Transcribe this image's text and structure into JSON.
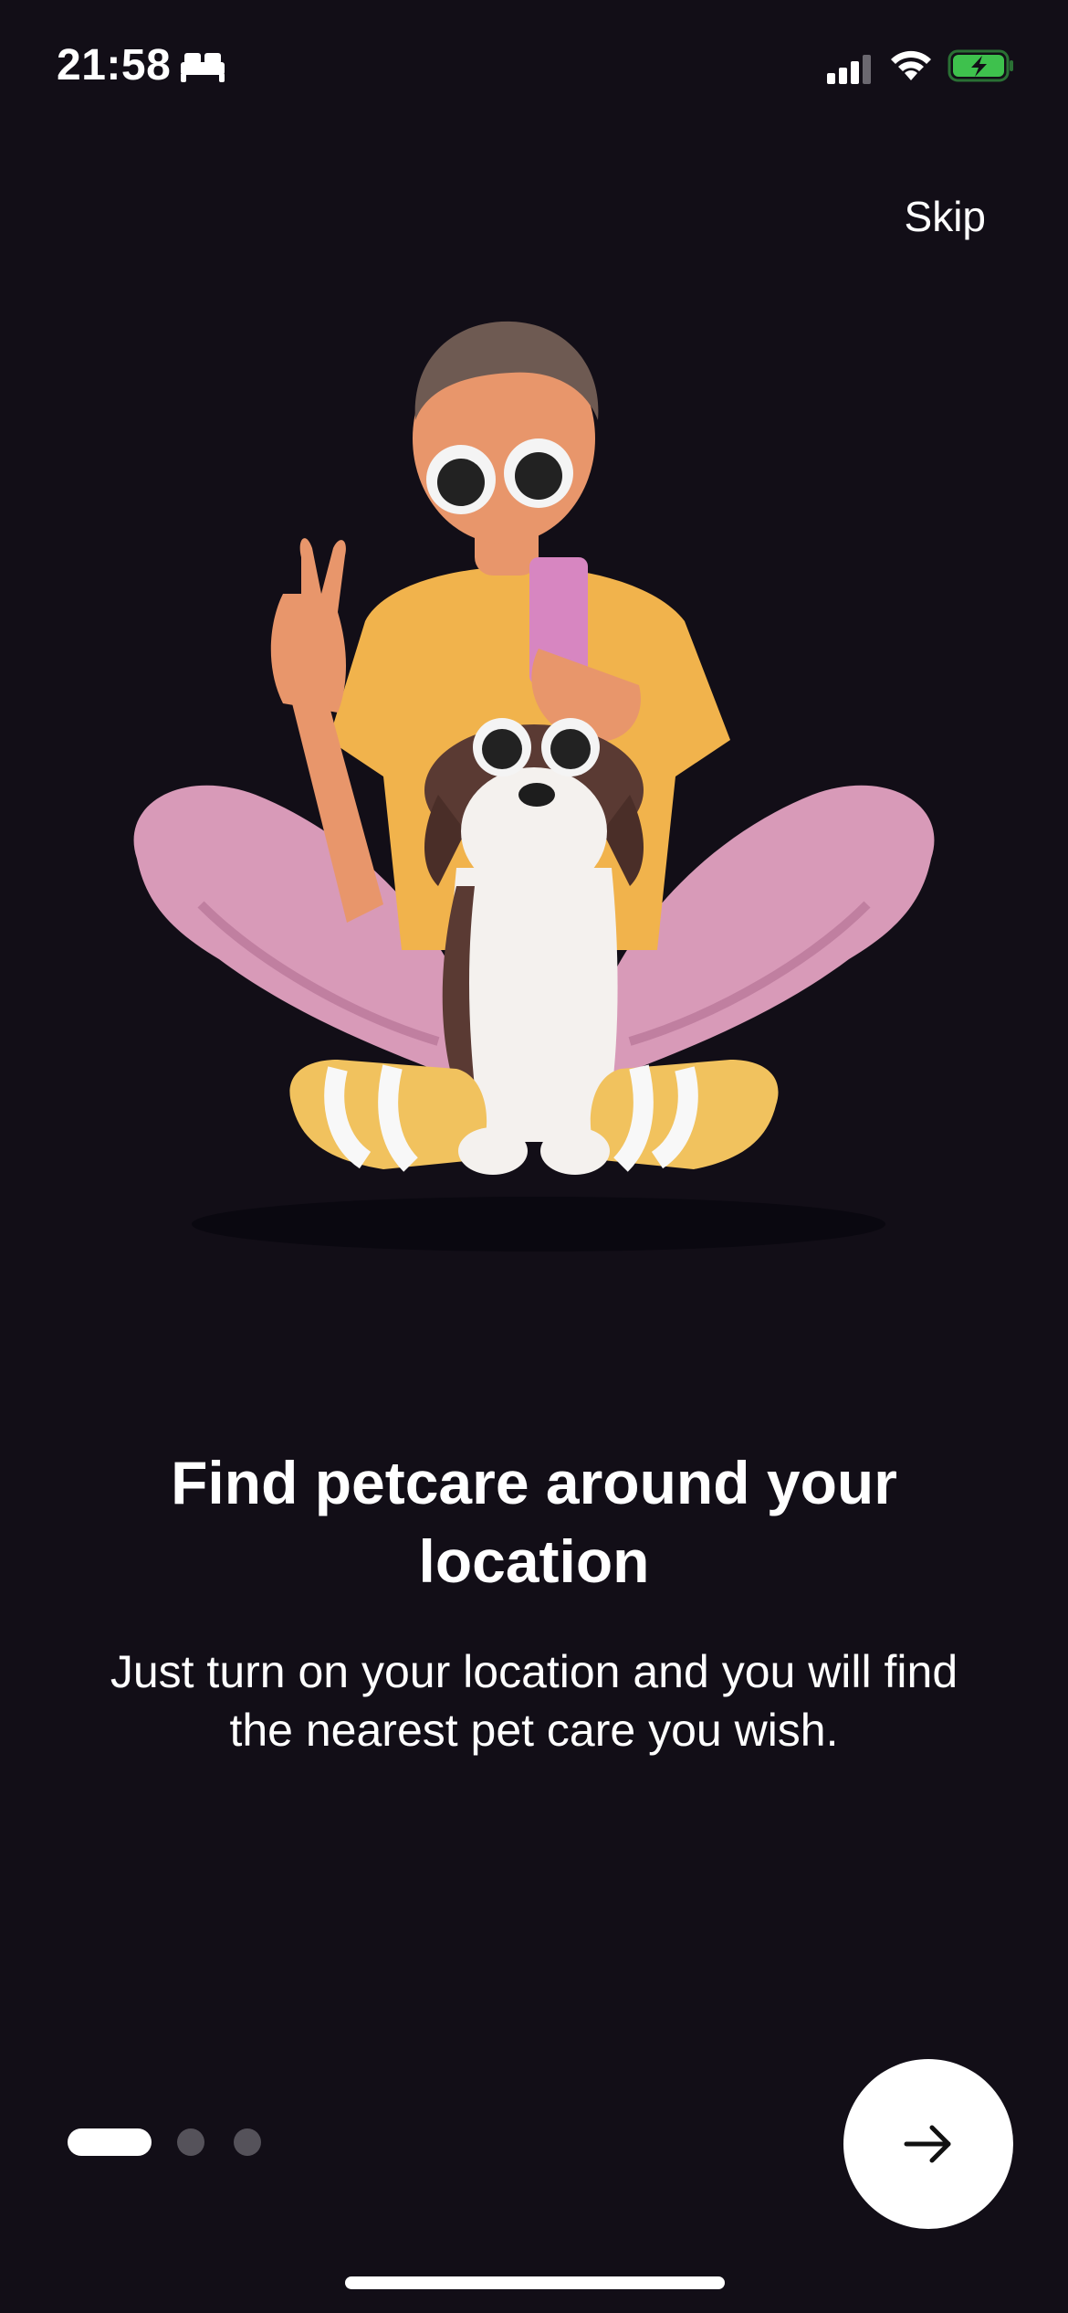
{
  "status_bar": {
    "time": "21:58",
    "icons": [
      "bed-icon",
      "cellular-signal-icon",
      "wifi-icon",
      "battery-charging-icon"
    ],
    "battery_color": "#3ec14d"
  },
  "header": {
    "skip_label": "Skip"
  },
  "illustration": {
    "description_icon": "person-with-dog-illustration"
  },
  "onboarding": {
    "title": "Find petcare around your location",
    "subtitle": "Just turn on your location and you will find the nearest pet care you wish.",
    "current_page": 1,
    "total_pages": 3
  },
  "navigation": {
    "next_icon": "arrow-right-icon"
  },
  "colors": {
    "background": "#120e17",
    "text": "#ffffff",
    "inactive_dot": "#55525a",
    "accent_button": "#ffffff"
  }
}
